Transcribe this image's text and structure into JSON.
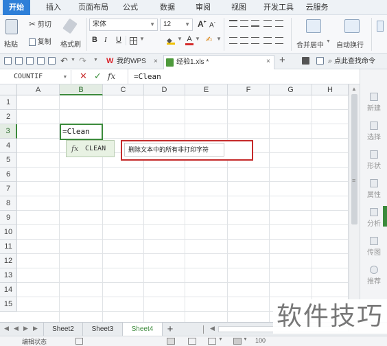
{
  "menu": {
    "tabs": [
      "开始",
      "插入",
      "页面布局",
      "公式",
      "数据",
      "审阅",
      "视图",
      "开发工具",
      "云服务"
    ],
    "active_index": 0
  },
  "ribbon": {
    "paste_label": "粘贴",
    "cut_label": "剪切",
    "copy_label": "复制",
    "format_painter_label": "格式刷",
    "font_name": "宋体",
    "font_size": "12",
    "bold": "B",
    "italic": "I",
    "underline": "U",
    "increase_font": "A",
    "decrease_font": "A",
    "merge_label": "合并居中",
    "wrap_label": "自动换行"
  },
  "quickbar": {
    "tabs": [
      {
        "label": "我的WPS",
        "close": "×"
      },
      {
        "label": "经验1.xls *",
        "close": "×"
      }
    ],
    "add": "+",
    "search_label": "点此查找命令"
  },
  "formula_bar": {
    "name_box": "COUNTIF",
    "cancel": "✕",
    "confirm": "✓",
    "fx": "fx",
    "content": "=Clean"
  },
  "grid": {
    "columns": [
      "A",
      "B",
      "C",
      "D",
      "E",
      "F",
      "G",
      "H"
    ],
    "rows": [
      "1",
      "2",
      "3",
      "4",
      "5",
      "6",
      "7",
      "8",
      "9",
      "10",
      "11",
      "12",
      "13",
      "14",
      "15"
    ],
    "selected_column": "B",
    "selected_row": "3",
    "active_cell_text": "=Clean"
  },
  "autocomplete": {
    "fx": "fx",
    "function_name": "CLEAN",
    "tooltip": "删除文本中的所有非打印字符"
  },
  "side_panel": {
    "items": [
      "新建",
      "选择",
      "形状",
      "属性",
      "分析",
      "传图",
      "推荐"
    ]
  },
  "sheets": {
    "tabs": [
      "Sheet2",
      "Sheet3",
      "Sheet4"
    ],
    "active": "Sheet4",
    "add": "+"
  },
  "status": {
    "mode": "编辑状态",
    "zoom": "100"
  },
  "watermark": "软件技巧"
}
